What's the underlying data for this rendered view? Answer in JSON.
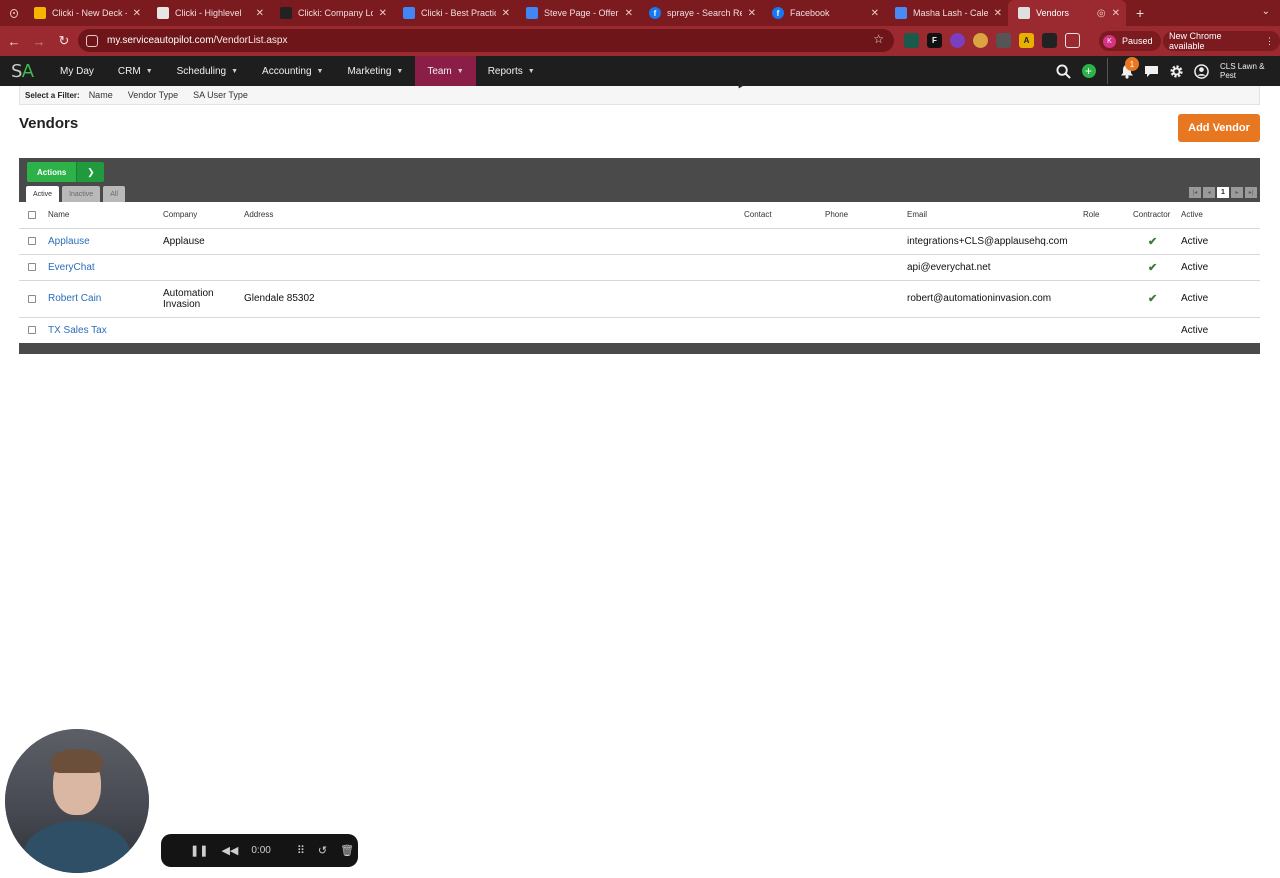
{
  "browser": {
    "tabs": [
      {
        "title": "Clicki - New Deck - G",
        "fav": "#f4b400",
        "glyph": ""
      },
      {
        "title": "Clicki - Highlevel",
        "fav": "#e6e6e6",
        "glyph": ""
      },
      {
        "title": "Clicki: Company Logi",
        "fav": "#222222",
        "glyph": ""
      },
      {
        "title": "Clicki - Best Practice",
        "fav": "#4285f4",
        "glyph": ""
      },
      {
        "title": "Steve Page - Offer Le",
        "fav": "#4285f4",
        "glyph": ""
      },
      {
        "title": "spraye - Search Resu",
        "fav": "#1877f2",
        "glyph": "f"
      },
      {
        "title": "Facebook",
        "fav": "#1877f2",
        "glyph": "f"
      },
      {
        "title": "Masha Lash - Calend",
        "fav": "#4a8af4",
        "glyph": ""
      },
      {
        "title": "Vendors",
        "fav": "#e0e0e0",
        "glyph": ""
      }
    ],
    "url_domain": "my.serviceautopilot.com",
    "url_path": "/VendorList.aspx",
    "profile_initial": "K",
    "profile_status": "Paused",
    "update_label": "New Chrome available"
  },
  "appnav": {
    "logo_s": "S",
    "logo_a": "A",
    "items": [
      "My Day",
      "CRM",
      "Scheduling",
      "Accounting",
      "Marketing",
      "Team",
      "Reports"
    ],
    "notification_count": "1",
    "company": "CLS Lawn & Pest"
  },
  "filter": {
    "label": "Select a Filter:",
    "options": [
      "Name",
      "Vendor Type",
      "SA User Type"
    ]
  },
  "page": {
    "title": "Vendors",
    "add_button": "Add Vendor"
  },
  "grid": {
    "actions_label": "Actions",
    "tabs": [
      "Active",
      "Inactive",
      "All"
    ],
    "current_page": "1",
    "columns": [
      "Name",
      "Company",
      "Address",
      "Contact",
      "Phone",
      "Email",
      "Role",
      "Contractor",
      "Active"
    ],
    "rows": [
      {
        "name": "Applause",
        "company": "Applause",
        "address": "",
        "contact": "",
        "phone": "",
        "email": "integrations+CLS@applausehq.com",
        "role": "",
        "contractor": true,
        "active": "Active"
      },
      {
        "name": "EveryChat",
        "company": "",
        "address": "",
        "contact": "",
        "phone": "",
        "email": "api@everychat.net",
        "role": "",
        "contractor": true,
        "active": "Active"
      },
      {
        "name": "Robert Cain",
        "company": "Automation Invasion",
        "address": "Glendale 85302",
        "contact": "",
        "phone": "",
        "email": "robert@automationinvasion.com",
        "role": "",
        "contractor": true,
        "active": "Active"
      },
      {
        "name": "TX Sales Tax",
        "company": "",
        "address": "",
        "contact": "",
        "phone": "",
        "email": "",
        "role": "",
        "contractor": false,
        "active": "Active"
      }
    ]
  },
  "recorder": {
    "time": "0:00"
  }
}
